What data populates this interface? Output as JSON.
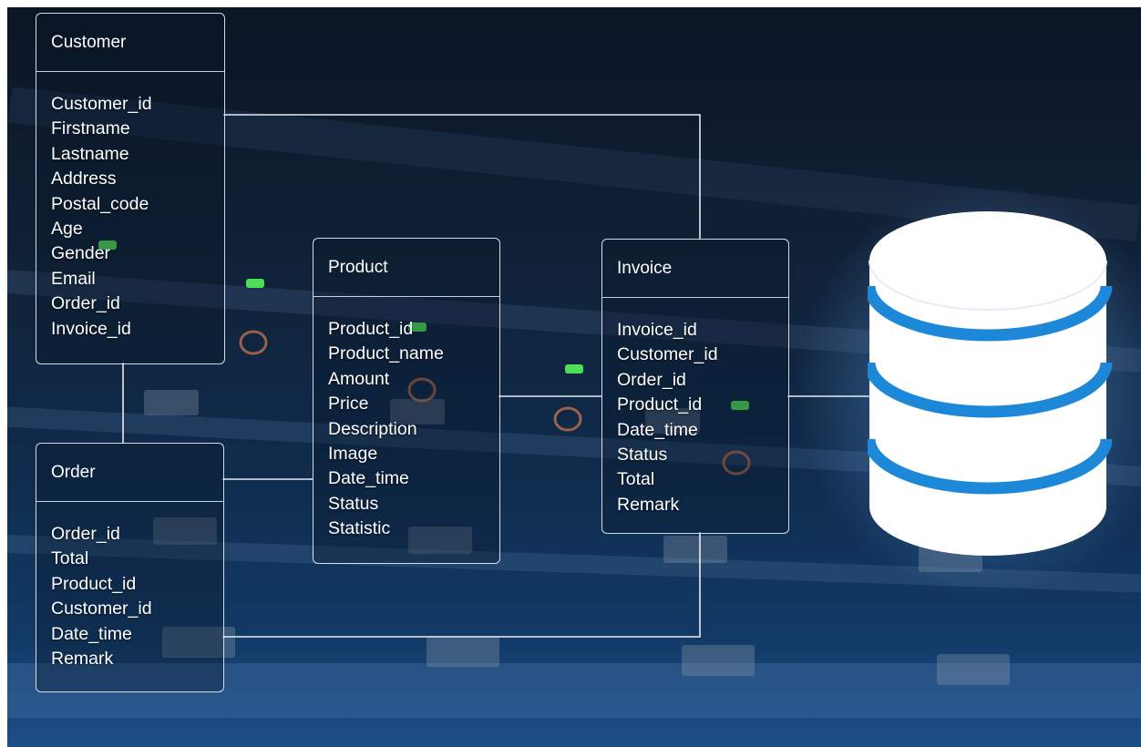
{
  "entities": [
    {
      "id": "customer",
      "name": "Customer",
      "fields": [
        "Customer_id",
        "Firstname",
        "Lastname",
        "Address",
        "Postal_code",
        "Age",
        "Gender",
        "Email",
        "Order_id",
        "Invoice_id"
      ]
    },
    {
      "id": "product",
      "name": "Product",
      "fields": [
        "Product_id",
        "Product_name",
        "Amount",
        "Price",
        "Description",
        "Image",
        "Date_time",
        "Status",
        "Statistic"
      ]
    },
    {
      "id": "invoice",
      "name": "Invoice",
      "fields": [
        "Invoice_id",
        "Customer_id",
        "Order_id",
        "Product_id",
        "Date_time",
        "Status",
        "Total",
        "Remark"
      ]
    },
    {
      "id": "order",
      "name": "Order",
      "fields": [
        "Order_id",
        "Total",
        "Product_id",
        "Customer_id",
        "Date_time",
        "Remark"
      ]
    }
  ],
  "relationships": [
    {
      "from": "customer",
      "to": "invoice"
    },
    {
      "from": "customer",
      "to": "order"
    },
    {
      "from": "order",
      "to": "product"
    },
    {
      "from": "product",
      "to": "invoice"
    },
    {
      "from": "order",
      "to": "invoice"
    },
    {
      "from": "invoice",
      "to": "database"
    }
  ],
  "database_icon": "database-cylinder-icon",
  "colors": {
    "line": "#e6ecf5",
    "db_body": "#ffffff",
    "db_band": "#1e88d8",
    "background": "#0f2a4a"
  }
}
